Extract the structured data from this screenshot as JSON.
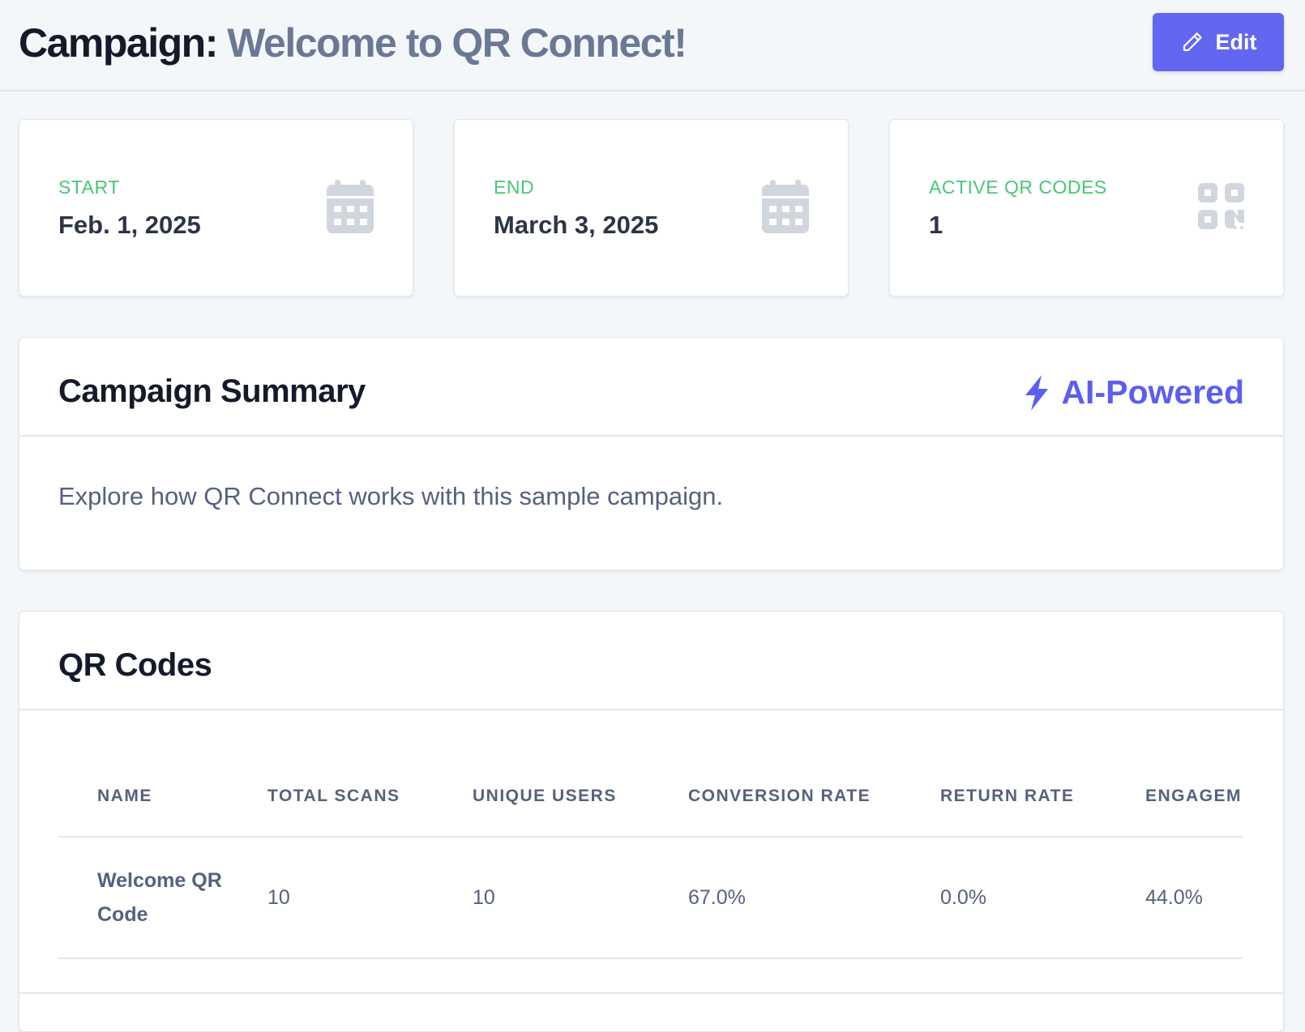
{
  "header": {
    "title_prefix": "Campaign:",
    "campaign_name": "Welcome to QR Connect!",
    "edit_label": "Edit"
  },
  "stats": [
    {
      "label": "START",
      "value": "Feb. 1, 2025",
      "icon": "calendar-icon"
    },
    {
      "label": "END",
      "value": "March 3, 2025",
      "icon": "calendar-icon"
    },
    {
      "label": "ACTIVE QR CODES",
      "value": "1",
      "icon": "qr-code-icon"
    }
  ],
  "summary": {
    "title": "Campaign Summary",
    "badge": "AI-Powered",
    "text": "Explore how QR Connect works with this sample campaign."
  },
  "qr_codes": {
    "title": "QR Codes",
    "columns": [
      "NAME",
      "TOTAL SCANS",
      "UNIQUE USERS",
      "CONVERSION RATE",
      "RETURN RATE",
      "ENGAGEME"
    ],
    "rows": [
      {
        "name": "Welcome QR Code",
        "total_scans": "10",
        "unique_users": "10",
        "conversion_rate": "67.0%",
        "return_rate": "0.0%",
        "engagement": "44.0%"
      }
    ]
  },
  "colors": {
    "accent": "#6366f1",
    "label_green": "#48c774",
    "icon_gray": "#d1d6de"
  }
}
